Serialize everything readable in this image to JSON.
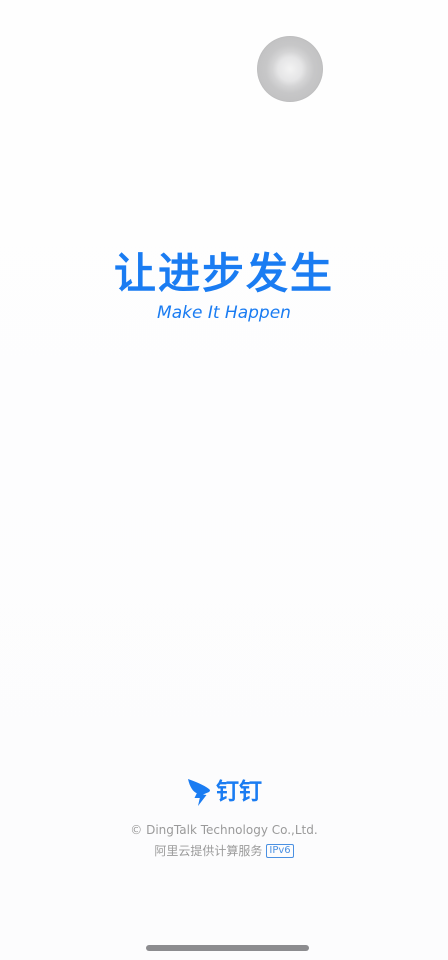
{
  "splash": {
    "slogan": "让进步发生",
    "tagline": "Make It Happen"
  },
  "brand": {
    "name": "钉钉",
    "logo_icon": "dingtalk-wing-icon",
    "color": "#1a7cf2"
  },
  "footer": {
    "copyright": "© DingTalk Technology Co.,Ltd.",
    "provider": "阿里云提供计算服务",
    "badge": "IPv6"
  },
  "overlay": {
    "assistive_touch_icon": "assistive-touch-icon"
  }
}
